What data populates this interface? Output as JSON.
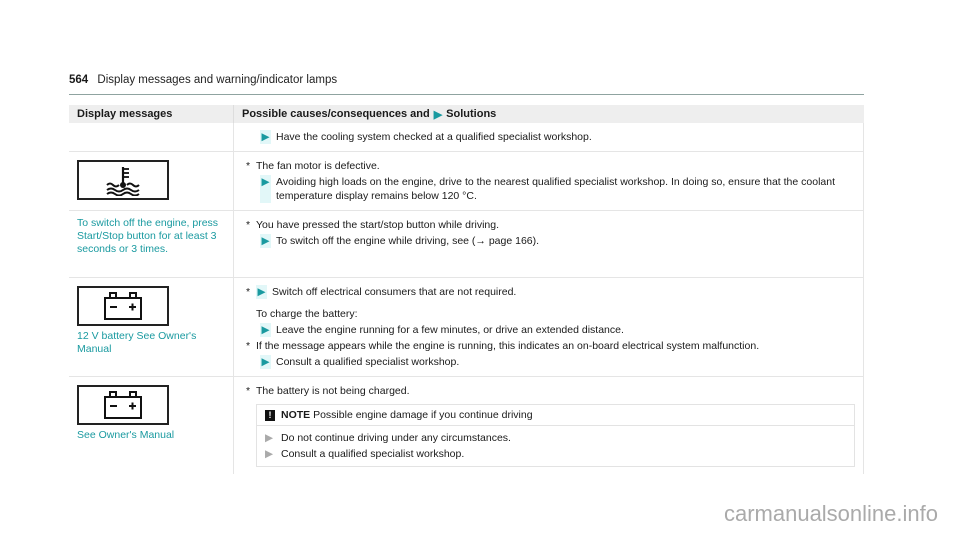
{
  "header": {
    "page_number": "564",
    "title": "Display messages and warning/indicator lamps"
  },
  "table": {
    "col1_header": "Display messages",
    "col2_header_prefix": "Possible causes/consequences and",
    "col2_header_suffix": "Solutions",
    "rows": [
      {
        "solutions": [
          "Have the cooling system checked at a qualified specialist workshop."
        ]
      },
      {
        "icon": "coolant-temperature-icon",
        "cause": "The fan motor is defective.",
        "solutions": [
          "Avoiding high loads on the engine, drive to the nearest qualified specialist workshop. In doing so, ensure that the coolant temperature display remains below 120 °C."
        ]
      },
      {
        "message": "To switch off the engine, press Start/Stop button for at least 3 seconds or 3 times.",
        "cause": "You have pressed the start/stop button while driving.",
        "solutions": [
          "To switch off the engine while driving, see (→ page 166)."
        ]
      },
      {
        "icon": "battery-icon",
        "message": "12 V battery See Owner's Manual",
        "step1": "Switch off electrical consumers that are not required.",
        "charge_label": "To charge the battery:",
        "step2": "Leave the engine running for a few minutes, or drive an extended distance.",
        "cause2": "If the message appears while the engine is running, this indicates an on-board electrical system malfunction.",
        "step3": "Consult a qualified specialist workshop."
      },
      {
        "icon": "battery-icon",
        "message": "See Owner's Manual",
        "cause": "The battery is not being charged.",
        "note": {
          "label": "NOTE",
          "text": "Possible engine damage if you continue driving",
          "items": [
            "Do not continue driving under any circumstances.",
            "Consult a qualified specialist workshop."
          ]
        }
      }
    ]
  },
  "watermark": "carmanualsonline.info",
  "colors": {
    "accent": "#1a9aa0",
    "header_bg": "#eeeeee"
  }
}
